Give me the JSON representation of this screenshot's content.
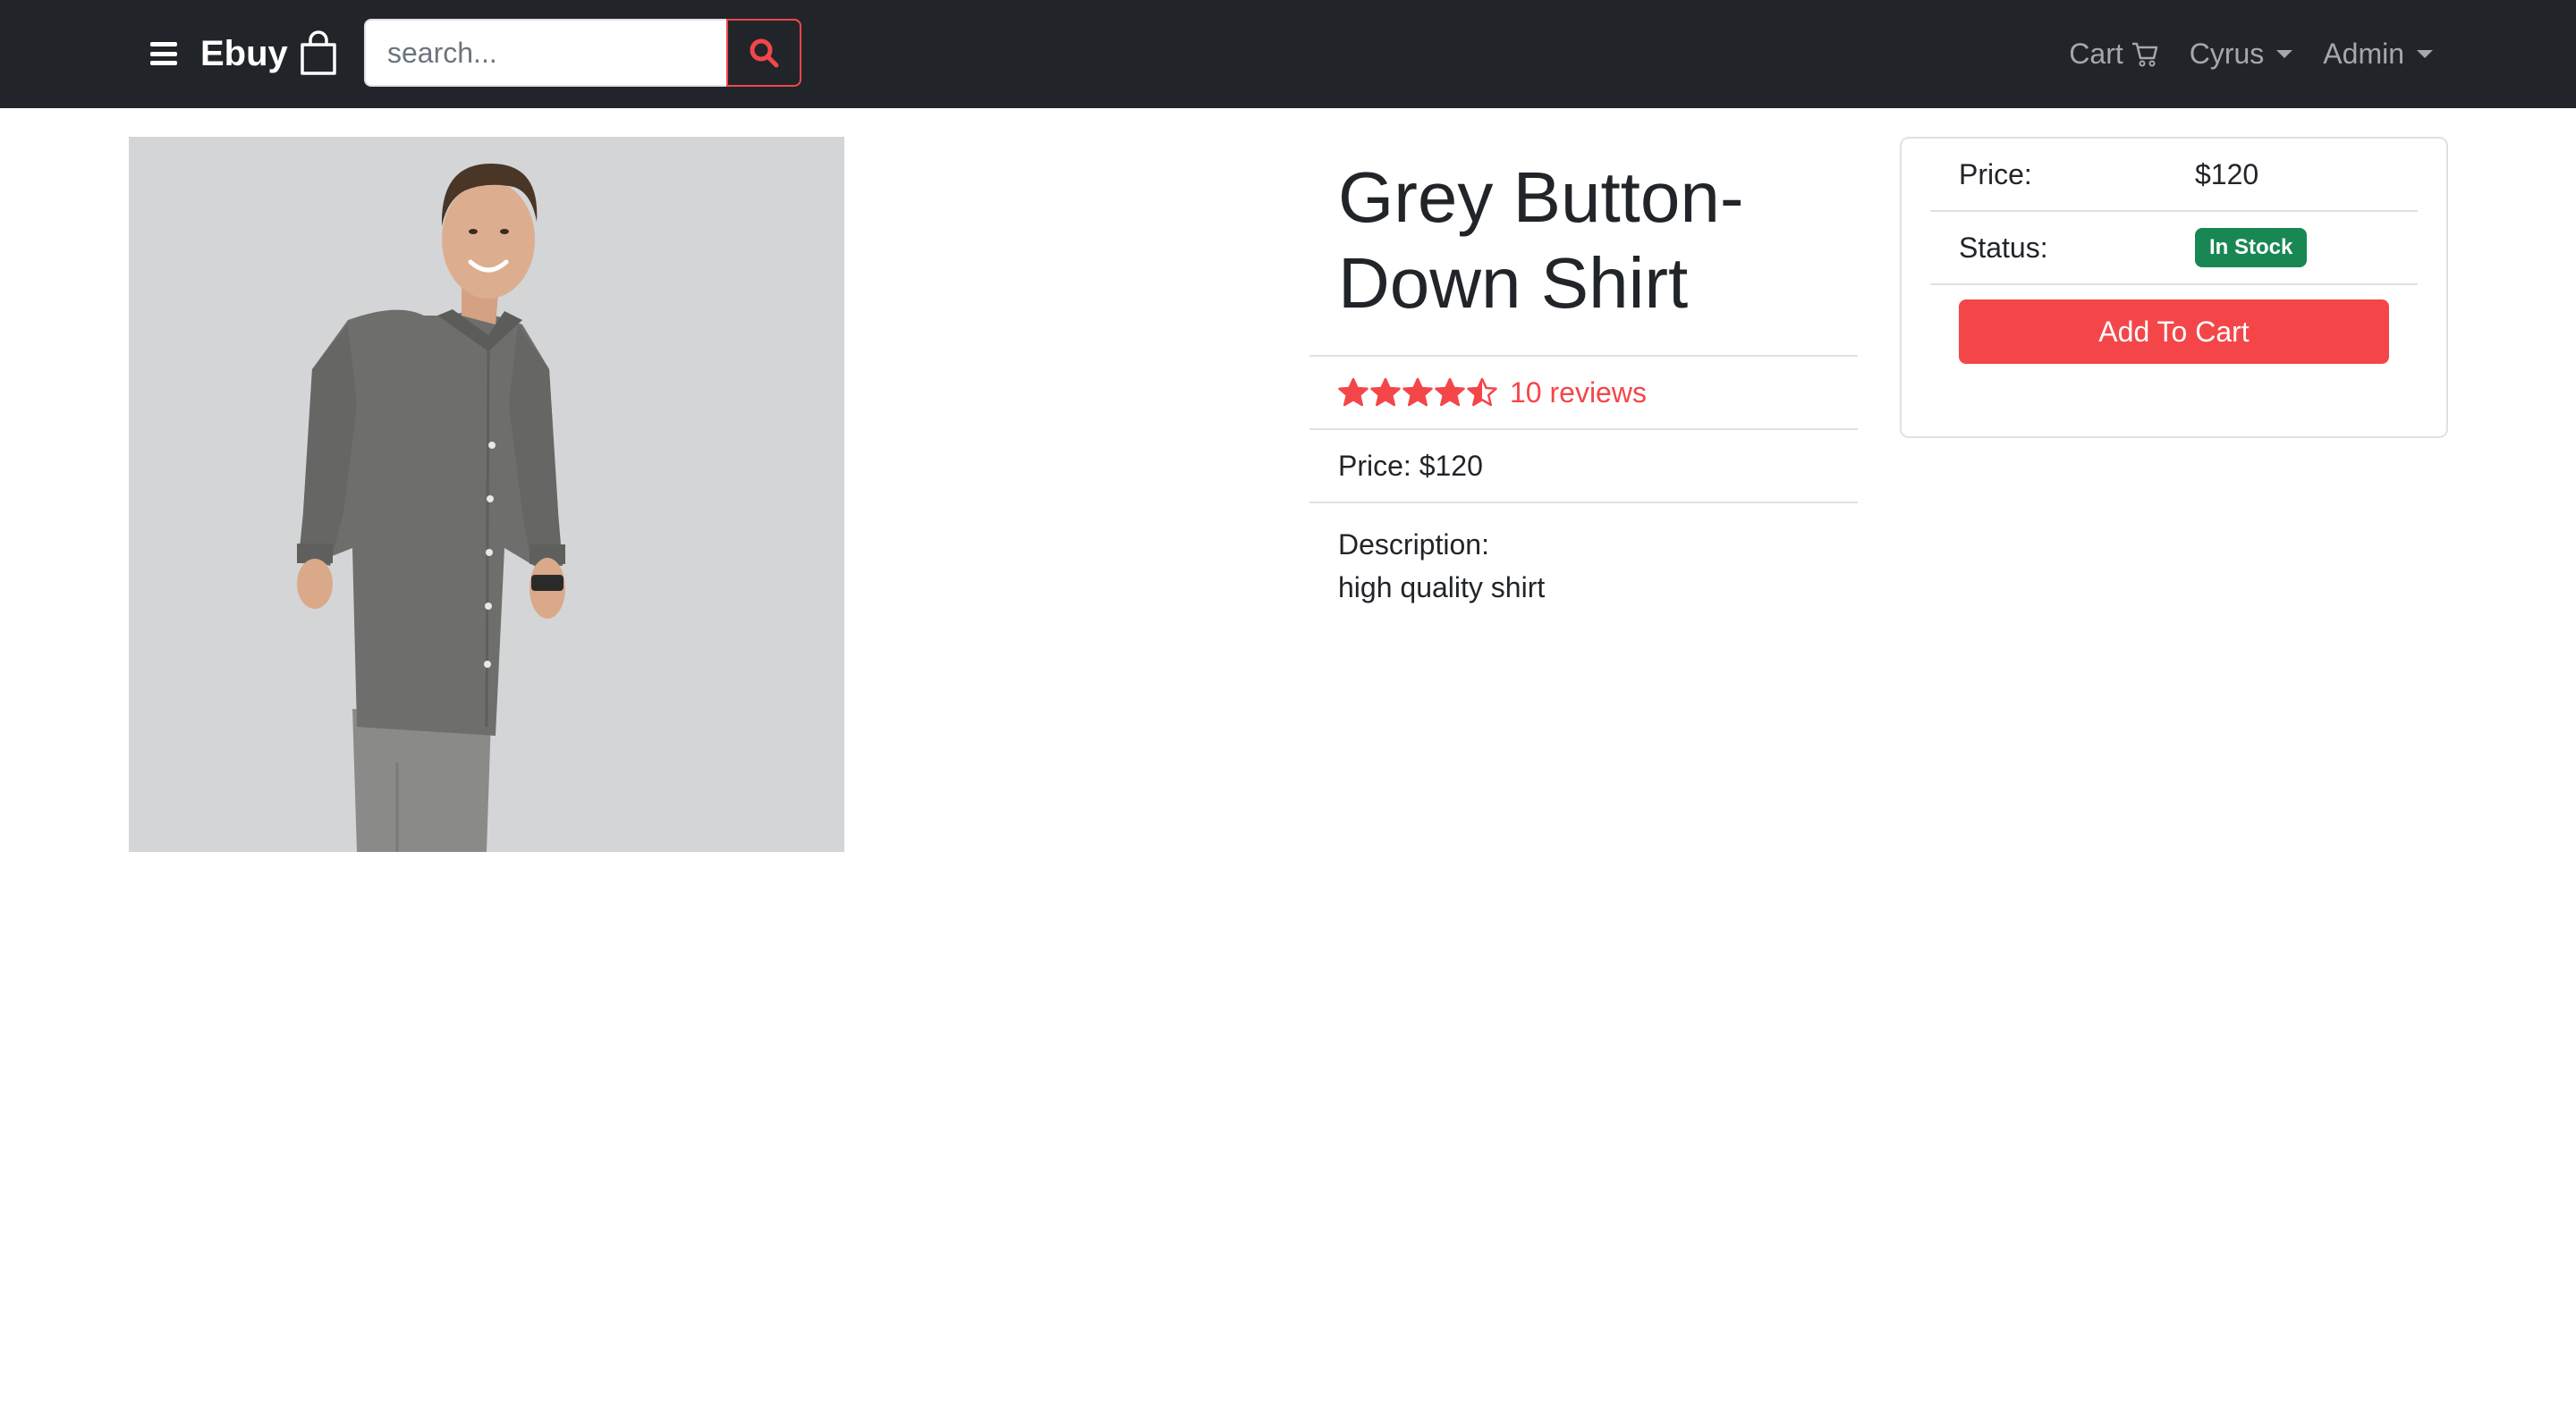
{
  "navbar": {
    "brand": "Ebuy",
    "search_placeholder": "search...",
    "cart_label": "Cart",
    "user_menu_label": "Cyrus",
    "admin_menu_label": "Admin"
  },
  "product": {
    "title": "Grey Button-Down Shirt",
    "rating": 4.5,
    "rating_max": 5,
    "reviews_text": "10 reviews",
    "price_line": "Price: $120",
    "description_label": "Description:",
    "description": "high quality shirt"
  },
  "cart_card": {
    "price_label": "Price:",
    "price_value": "$120",
    "status_label": "Status:",
    "status_value": "In Stock",
    "add_button_label": "Add To Cart"
  },
  "colors": {
    "navbar_bg": "#212529",
    "accent_red": "#f44649",
    "success_green": "#198754",
    "image_bg": "#d4d5d7"
  },
  "icons": {
    "menu": "hamburger-icon",
    "brand": "shopping-bag-icon",
    "search": "search-icon",
    "cart": "cart-icon",
    "rating": "star-icon"
  }
}
